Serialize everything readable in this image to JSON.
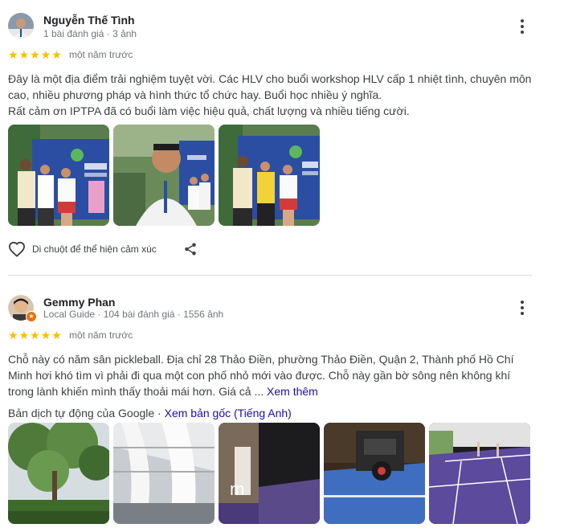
{
  "reviews": [
    {
      "reviewer": "Nguyễn Thế Tình",
      "meta": "1 bài đánh giá · 3 ảnh",
      "rating": 5,
      "date": "một năm trước",
      "text_lines": [
        "Đây là một địa điểm trải nghiệm tuyệt vời. Các HLV cho buổi workshop HLV cấp 1 nhiệt tình, chuyên môn",
        "cao, nhiều phương pháp và hình thức tổ chức hay. Buổi học nhiều ý nghĩa.",
        "Rất cảm ơn IPTPA đã có buổi làm việc hiệu quả, chất lượng và nhiều tiếng cười."
      ],
      "hover_reaction": "Di chuột để thể hiện cảm xúc"
    },
    {
      "reviewer": "Gemmy Phan",
      "meta": "Local Guide · 104 bài đánh giá · 1556 ảnh",
      "rating": 5,
      "date": "một năm trước",
      "text_lines": [
        "Chỗ này có năm sân pickleball. Địa chỉ 28 Thảo Điền, phường Thảo Điền, Quận 2, Thành phố Hồ Chí",
        "Minh hơi khó tìm vì phải đi qua một con phố nhỏ mới vào được. Chỗ này gần bờ sông nên không khí",
        "trong lành khiến mình thấy thoải mái hơn. Giá cả ..."
      ],
      "see_more": "Xem thêm",
      "translate_note": "Bản dịch tự động của Google ·",
      "translate_link": "Xem bản gốc (Tiếng Anh)"
    }
  ],
  "colors": {
    "star": "#fbbc04",
    "link": "#1a0dab",
    "divider": "#dadce0"
  },
  "icons": [
    "more-vert-icon",
    "star-icon",
    "heart-outline-icon",
    "share-icon",
    "local-guide-badge-icon"
  ]
}
